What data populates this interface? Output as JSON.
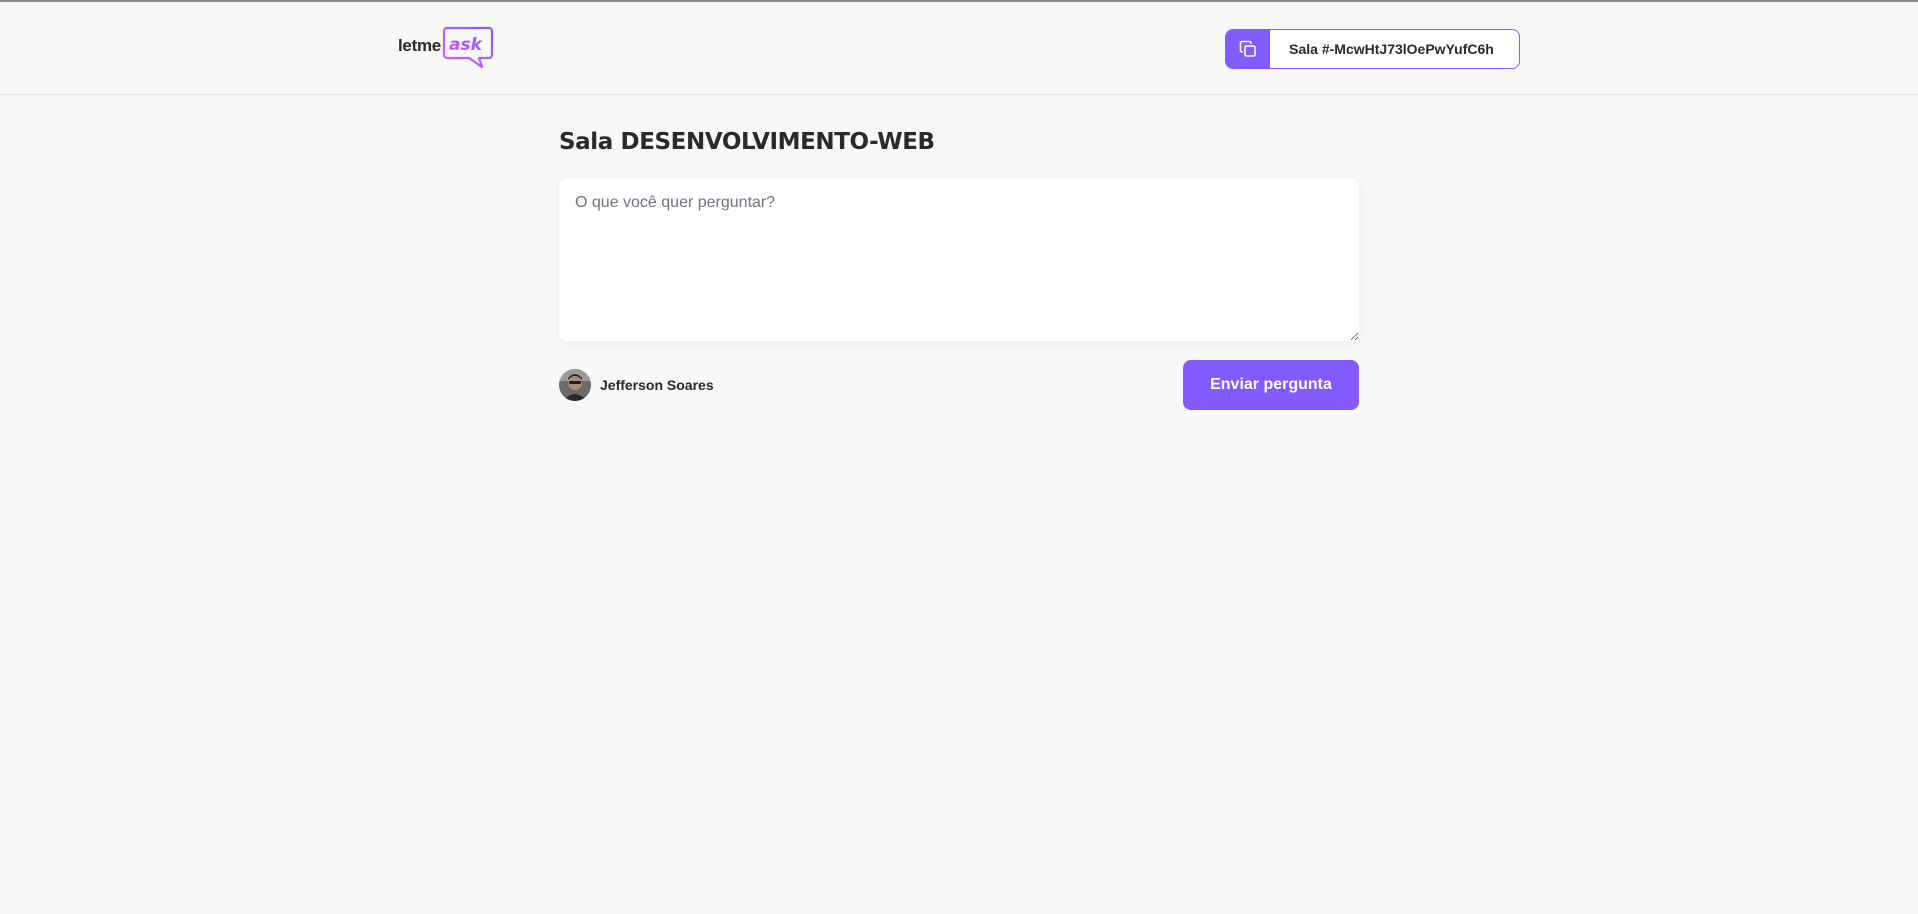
{
  "header": {
    "logo": {
      "text_plain": "letme",
      "text_accent": "ask"
    },
    "room_code": {
      "label": "Sala #-McwHtJ73lOePwYufC6h",
      "icon": "copy-icon"
    }
  },
  "main": {
    "title": "Sala DESENVOLVIMENTO-WEB",
    "question": {
      "placeholder": "O que você quer perguntar?",
      "value": ""
    },
    "user": {
      "name": "Jefferson Soares",
      "avatar": "user-avatar"
    },
    "send_button_label": "Enviar pergunta"
  },
  "colors": {
    "background": "#f8f8f8",
    "accent": "#835afd",
    "logo_gradient_start": "#e559f9",
    "text": "#29292e",
    "muted": "#737380"
  }
}
